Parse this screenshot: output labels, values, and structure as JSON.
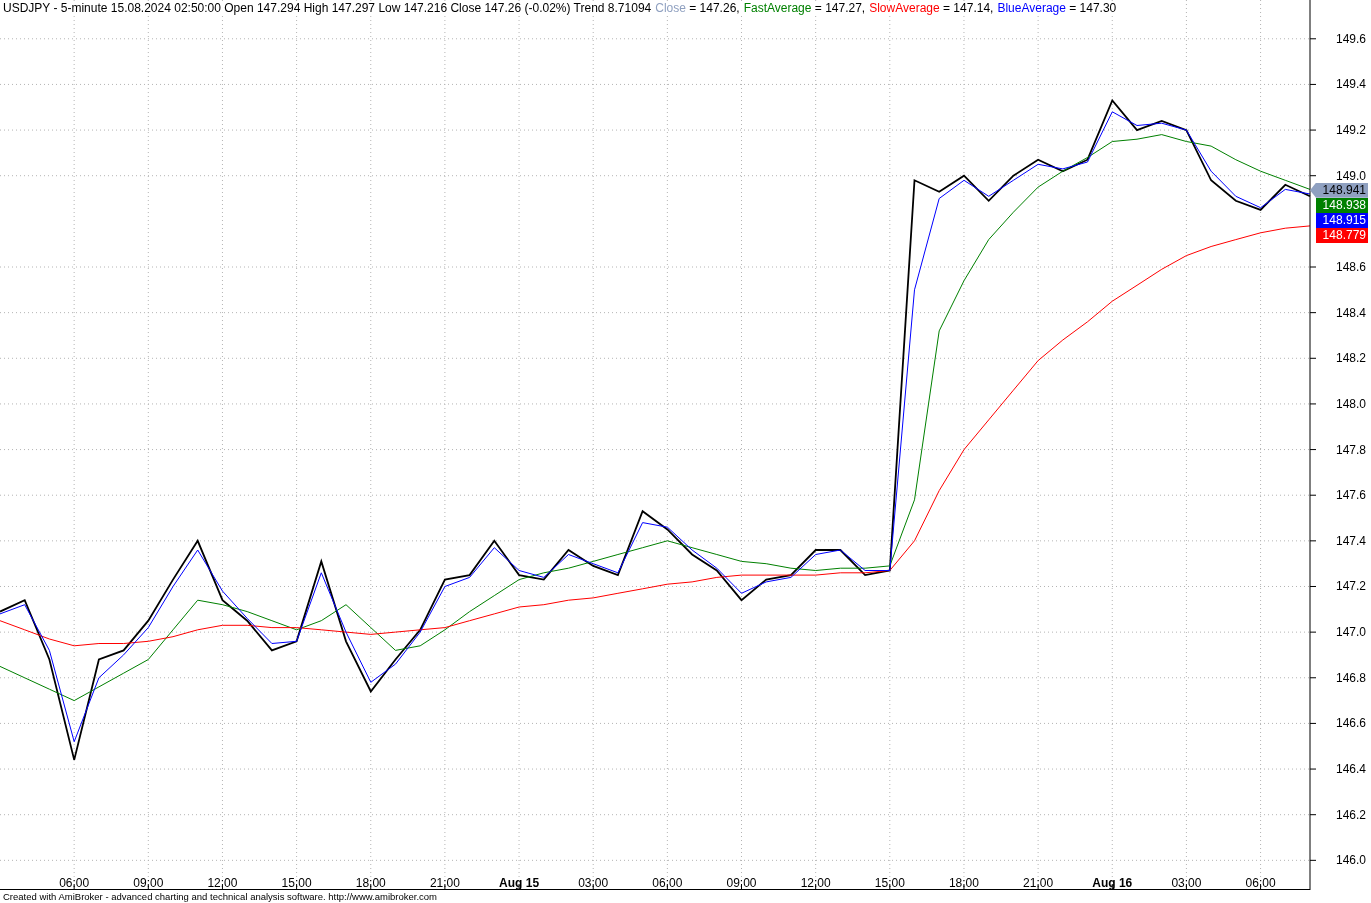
{
  "header": {
    "title": "USDJPY - 5-minute 15.08.2024 02:50:00 Open 147.294 High 147.297 Low 147.216 Close 147.26 (-0.02%) Trend 8.71094",
    "legend": [
      {
        "value": "= 147.26,",
        "color": "#8fa0c0"
      },
      {
        "value": "= 147.27,",
        "color": "#008000"
      },
      {
        "value": "= 147.14,",
        "color": "#ff0000"
      },
      {
        "value": "= 147.30",
        "color": "#0000ff"
      }
    ]
  },
  "chart": {
    "chart_data": {
      "type": "line",
      "grid": true,
      "x": [
        "2024-08-14 03:00",
        "2024-08-14 04:00",
        "2024-08-14 05:00",
        "2024-08-14 06:00",
        "2024-08-14 07:00",
        "2024-08-14 08:00",
        "2024-08-14 09:00",
        "2024-08-14 10:00",
        "2024-08-14 11:00",
        "2024-08-14 12:00",
        "2024-08-14 13:00",
        "2024-08-14 14:00",
        "2024-08-14 15:00",
        "2024-08-14 16:00",
        "2024-08-14 17:00",
        "2024-08-14 18:00",
        "2024-08-14 19:00",
        "2024-08-14 20:00",
        "2024-08-14 21:00",
        "2024-08-14 22:00",
        "2024-08-14 23:00",
        "2024-08-15 00:00",
        "2024-08-15 01:00",
        "2024-08-15 02:00",
        "2024-08-15 03:00",
        "2024-08-15 04:00",
        "2024-08-15 05:00",
        "2024-08-15 06:00",
        "2024-08-15 07:00",
        "2024-08-15 08:00",
        "2024-08-15 09:00",
        "2024-08-15 10:00",
        "2024-08-15 11:00",
        "2024-08-15 12:00",
        "2024-08-15 13:00",
        "2024-08-15 14:00",
        "2024-08-15 15:00",
        "2024-08-15 16:00",
        "2024-08-15 17:00",
        "2024-08-15 18:00",
        "2024-08-15 19:00",
        "2024-08-15 20:00",
        "2024-08-15 21:00",
        "2024-08-15 22:00",
        "2024-08-15 23:00",
        "2024-08-16 00:00",
        "2024-08-16 01:00",
        "2024-08-16 02:00",
        "2024-08-16 03:00",
        "2024-08-16 04:00",
        "2024-08-16 05:00",
        "2024-08-16 06:00",
        "2024-08-16 07:00",
        "2024-08-16 08:00"
      ],
      "series": [
        {
          "name": "Close",
          "color": "#000000",
          "values": [
            147.09,
            147.14,
            146.88,
            146.44,
            146.88,
            146.92,
            147.05,
            147.23,
            147.4,
            147.14,
            147.05,
            146.92,
            146.96,
            147.31,
            146.96,
            146.74,
            146.88,
            147.01,
            147.23,
            147.25,
            147.4,
            147.25,
            147.23,
            147.36,
            147.29,
            147.25,
            147.53,
            147.45,
            147.34,
            147.27,
            147.14,
            147.23,
            147.25,
            147.36,
            147.36,
            147.25,
            147.27,
            148.98,
            148.93,
            149.0,
            148.89,
            149.0,
            149.07,
            149.02,
            149.07,
            149.33,
            149.2,
            149.24,
            149.2,
            148.98,
            148.89,
            148.85,
            148.96,
            148.91
          ]
        },
        {
          "name": "FastAverage",
          "color": "#008000",
          "values": [
            146.85,
            146.8,
            146.75,
            146.7,
            146.76,
            146.82,
            146.88,
            147.01,
            147.14,
            147.12,
            147.09,
            147.05,
            147.01,
            147.05,
            147.12,
            147.02,
            146.92,
            146.94,
            147.01,
            147.09,
            147.16,
            147.23,
            147.26,
            147.28,
            147.31,
            147.34,
            147.37,
            147.4,
            147.37,
            147.34,
            147.31,
            147.3,
            147.28,
            147.27,
            147.28,
            147.28,
            147.29,
            147.58,
            148.32,
            148.54,
            148.72,
            148.84,
            148.95,
            149.02,
            149.08,
            149.15,
            149.16,
            149.18,
            149.15,
            149.13,
            149.07,
            149.02,
            148.98,
            148.94
          ]
        },
        {
          "name": "SlowAverage",
          "color": "#ff0000",
          "values": [
            147.05,
            147.01,
            146.97,
            146.94,
            146.95,
            146.95,
            146.96,
            146.98,
            147.01,
            147.03,
            147.03,
            147.02,
            147.02,
            147.01,
            147.0,
            146.99,
            147.0,
            147.01,
            147.02,
            147.05,
            147.08,
            147.11,
            147.12,
            147.14,
            147.15,
            147.17,
            147.19,
            147.21,
            147.22,
            147.24,
            147.25,
            147.25,
            147.25,
            147.25,
            147.26,
            147.26,
            147.27,
            147.4,
            147.62,
            147.8,
            147.93,
            148.06,
            148.19,
            148.28,
            148.36,
            148.45,
            148.52,
            148.59,
            148.65,
            148.69,
            148.72,
            148.75,
            148.77,
            148.78
          ]
        },
        {
          "name": "BlueAverage",
          "color": "#0000ff",
          "values": [
            147.08,
            147.12,
            146.92,
            146.52,
            146.8,
            146.9,
            147.02,
            147.2,
            147.36,
            147.18,
            147.06,
            146.95,
            146.96,
            147.26,
            147.0,
            146.78,
            146.86,
            147.0,
            147.2,
            147.24,
            147.37,
            147.27,
            147.24,
            147.34,
            147.3,
            147.26,
            147.48,
            147.46,
            147.36,
            147.28,
            147.17,
            147.22,
            147.24,
            147.34,
            147.36,
            147.27,
            147.27,
            148.5,
            148.9,
            148.98,
            148.91,
            148.98,
            149.05,
            149.03,
            149.06,
            149.28,
            149.22,
            149.23,
            149.2,
            149.02,
            148.91,
            148.86,
            148.94,
            148.92
          ]
        }
      ],
      "xlim": [
        "2024-08-14 03:00",
        "2024-08-16 08:00"
      ],
      "ylim": [
        145.87,
        149.77
      ],
      "xticks": [
        {
          "value": "2024-08-14 06:00",
          "label": "06:00"
        },
        {
          "value": "2024-08-14 09:00",
          "label": "09:00"
        },
        {
          "value": "2024-08-14 12:00",
          "label": "12:00"
        },
        {
          "value": "2024-08-14 15:00",
          "label": "15:00"
        },
        {
          "value": "2024-08-14 18:00",
          "label": "18:00"
        },
        {
          "value": "2024-08-14 21:00",
          "label": "21:00"
        },
        {
          "value": "2024-08-15 00:00",
          "label": "Aug 15"
        },
        {
          "value": "2024-08-15 03:00",
          "label": "03:00"
        },
        {
          "value": "2024-08-15 06:00",
          "label": "06:00"
        },
        {
          "value": "2024-08-15 09:00",
          "label": "09:00"
        },
        {
          "value": "2024-08-15 12:00",
          "label": "12:00"
        },
        {
          "value": "2024-08-15 15:00",
          "label": "15:00"
        },
        {
          "value": "2024-08-15 18:00",
          "label": "18:00"
        },
        {
          "value": "2024-08-15 21:00",
          "label": "21:00"
        },
        {
          "value": "2024-08-16 00:00",
          "label": "Aug 16"
        },
        {
          "value": "2024-08-16 03:00",
          "label": "03:00"
        },
        {
          "value": "2024-08-16 06:00",
          "label": "06:00"
        }
      ],
      "yticks": [
        {
          "value": 146.0,
          "label": "146.0"
        },
        {
          "value": 146.2,
          "label": "146.2"
        },
        {
          "value": 146.4,
          "label": "146.4"
        },
        {
          "value": 146.6,
          "label": "146.6"
        },
        {
          "value": 146.8,
          "label": "146.8"
        },
        {
          "value": 147.0,
          "label": "147.0"
        },
        {
          "value": 147.2,
          "label": "147.2"
        },
        {
          "value": 147.4,
          "label": "147.4"
        },
        {
          "value": 147.6,
          "label": "147.6"
        },
        {
          "value": 147.8,
          "label": "147.8"
        },
        {
          "value": 148.0,
          "label": "148.0"
        },
        {
          "value": 148.2,
          "label": "148.2"
        },
        {
          "value": 148.4,
          "label": "148.4"
        },
        {
          "value": 148.6,
          "label": "148.6"
        },
        {
          "value": 149.0,
          "label": "149.0"
        },
        {
          "value": 149.2,
          "label": "149.2"
        },
        {
          "value": 149.4,
          "label": "149.4"
        },
        {
          "value": 149.6,
          "label": "149.6"
        }
      ]
    },
    "price_tags": [
      {
        "value": "148.941",
        "color": "#8fa0c0",
        "kind": "pointer"
      },
      {
        "value": "148.938",
        "color": "#008000",
        "kind": "plain"
      },
      {
        "value": "148.915",
        "color": "#0000ff",
        "kind": "plain"
      },
      {
        "value": "148.779",
        "color": "#ff0000",
        "kind": "plain"
      }
    ]
  },
  "footer": "Created with AmiBroker - advanced charting and technical analysis software. http://www.amibroker.com"
}
